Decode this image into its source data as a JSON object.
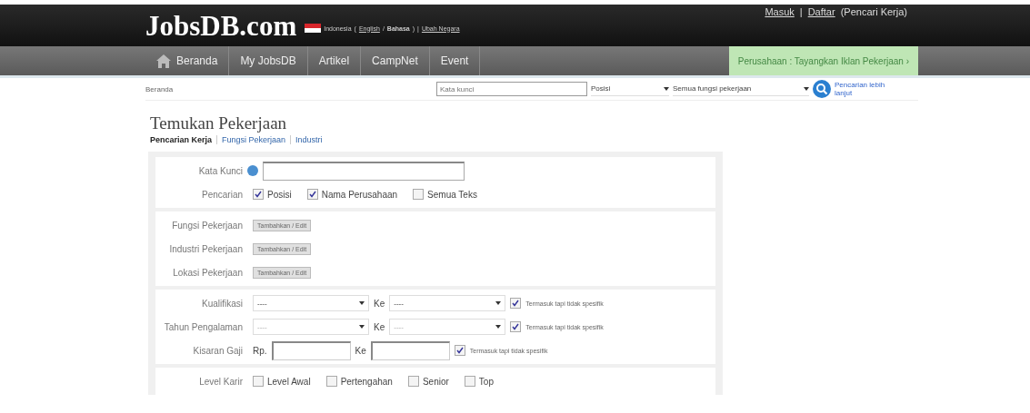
{
  "header": {
    "logo": "JobsDB.com",
    "country": "Indonesia",
    "lang_open": "(",
    "languages": [
      {
        "label": "English",
        "selected": false
      },
      {
        "label": "Bahasa",
        "selected": true
      }
    ],
    "lang_sep": "/",
    "lang_close": ")",
    "sep": "|",
    "change_country": "Ubah Negara",
    "login": "Masuk",
    "auth_sep": "|",
    "register": "Daftar",
    "register_note": "(Pencari Kerja)"
  },
  "nav": {
    "items": [
      {
        "label": "Beranda",
        "kind": "home"
      },
      {
        "label": "My JobsDB",
        "kind": "plain"
      },
      {
        "label": "Artikel",
        "kind": "plain"
      },
      {
        "label": "CampNet",
        "kind": "plain"
      },
      {
        "label": "Event",
        "kind": "plain"
      }
    ],
    "employer_link": "Perusahaan : Tayangkan Iklan Pekerjaan ›"
  },
  "breadcrumb": "Beranda",
  "quick_search": {
    "placeholder": "Kata kunci",
    "field": "Posisi",
    "function": "Semua fungsi pekerjaan",
    "advanced": "Pencarian lebih lanjut"
  },
  "title": "Temukan Pekerjaan",
  "tabs": [
    {
      "label": "Pencarian Kerja",
      "selected": true
    },
    {
      "label": "Fungsi Pekerjaan",
      "selected": false
    },
    {
      "label": "Industri",
      "selected": false
    }
  ],
  "form": {
    "keyword_label": "Kata Kunci",
    "search_label": "Pencarian",
    "search_in": [
      {
        "label": "Posisi",
        "checked": true
      },
      {
        "label": "Nama Perusahaan",
        "checked": true
      },
      {
        "label": "Semua Teks",
        "checked": false
      }
    ],
    "pickers": [
      {
        "label": "Fungsi Pekerjaan",
        "button": "Tambahkan / Edit"
      },
      {
        "label": "Industri Pekerjaan",
        "button": "Tambahkan / Edit"
      },
      {
        "label": "Lokasi Pekerjaan",
        "button": "Tambahkan / Edit"
      }
    ],
    "ranges": [
      {
        "label": "Kualifikasi",
        "from": "----",
        "to_label": "Ke",
        "to": "----",
        "include": "Termasuk tapi tidak spesifik",
        "checked": true,
        "disabled": false
      },
      {
        "label": "Tahun Pengalaman",
        "from": "----",
        "to_label": "Ke",
        "to": "----",
        "include": "Termasuk tapi tidak spesifik",
        "checked": true,
        "disabled": true
      }
    ],
    "salary": {
      "label": "Kisaran Gaji",
      "prefix": "Rp.",
      "to_label": "Ke",
      "include": "Termasuk tapi tidak spesifik",
      "checked": true
    },
    "career_label": "Level Karir",
    "career": [
      {
        "label": "Level Awal",
        "checked": false
      },
      {
        "label": "Pertengahan",
        "checked": false
      },
      {
        "label": "Senior",
        "checked": false
      },
      {
        "label": "Top",
        "checked": false
      }
    ]
  }
}
